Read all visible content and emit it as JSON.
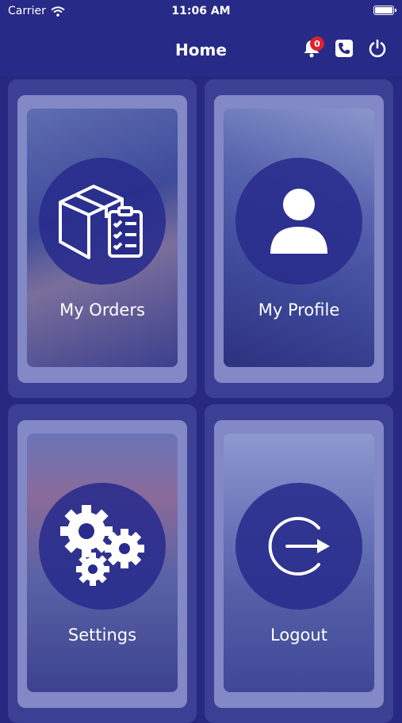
{
  "status_bar": {
    "carrier": "Carrier",
    "time": "11:06 AM"
  },
  "header": {
    "title": "Home",
    "notification_count": "0"
  },
  "tiles": [
    {
      "label": "My Orders",
      "icon": "package-checklist-icon"
    },
    {
      "label": "My Profile",
      "icon": "user-icon"
    },
    {
      "label": "Settings",
      "icon": "gears-icon"
    },
    {
      "label": "Logout",
      "icon": "logout-icon"
    }
  ]
}
